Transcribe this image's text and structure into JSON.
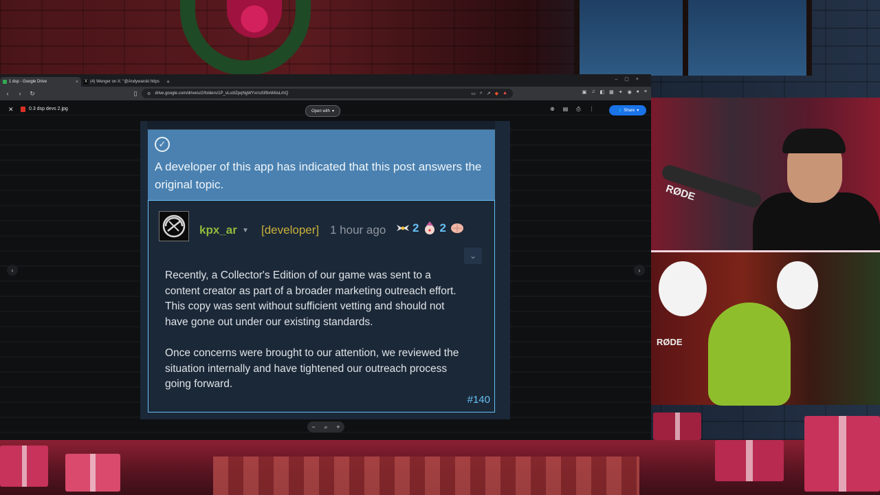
{
  "browser": {
    "tabs": [
      {
        "label": "1 dsp - Google Drive",
        "active": true
      },
      {
        "label": "(4) Wenger on X: \"@Andywarski https",
        "active": false
      }
    ],
    "address": "drive.google.com/drive/u/2/folders/1P_vLcdIZpqNgWYxr/uSif9xWiiisLrhQ"
  },
  "viewer": {
    "file_name": "0.3 dsp devs 2.jpg",
    "open_with_label": "Open with",
    "share_label": "Share",
    "zoom": {
      "minus": "−",
      "plus": "+"
    }
  },
  "post": {
    "answer_notice": "A developer of this app has indicated that this post answers the original topic.",
    "author": "kpx_ar",
    "developer_tag": "[developer]",
    "timestamp": "1 hour ago",
    "awards": [
      {
        "icon": "wings-award-icon",
        "count": "2"
      },
      {
        "icon": "clown-award-icon",
        "count": "2"
      },
      {
        "icon": "brain-award-icon",
        "count": ""
      }
    ],
    "paragraphs": [
      "Recently, a Collector's Edition of our game was sent to a content creator as part of a broader marketing outreach effort. This copy was sent without sufficient vetting and should not have gone out under our existing standards.",
      "Once concerns were brought to our attention, we reviewed the situation internally and have tightened our outreach process going forward."
    ],
    "post_number": "#140"
  },
  "overlay": {
    "mic_brand_top": "RØDE",
    "mic_brand_bottom": "RØDE"
  },
  "colors": {
    "steam_bg": "#1b2838",
    "answer_blue": "#4a81b0",
    "author_green": "#90ba3c",
    "dev_gold": "#c8b03a",
    "link_blue": "#66c0f4",
    "share_blue": "#1a73e8"
  }
}
